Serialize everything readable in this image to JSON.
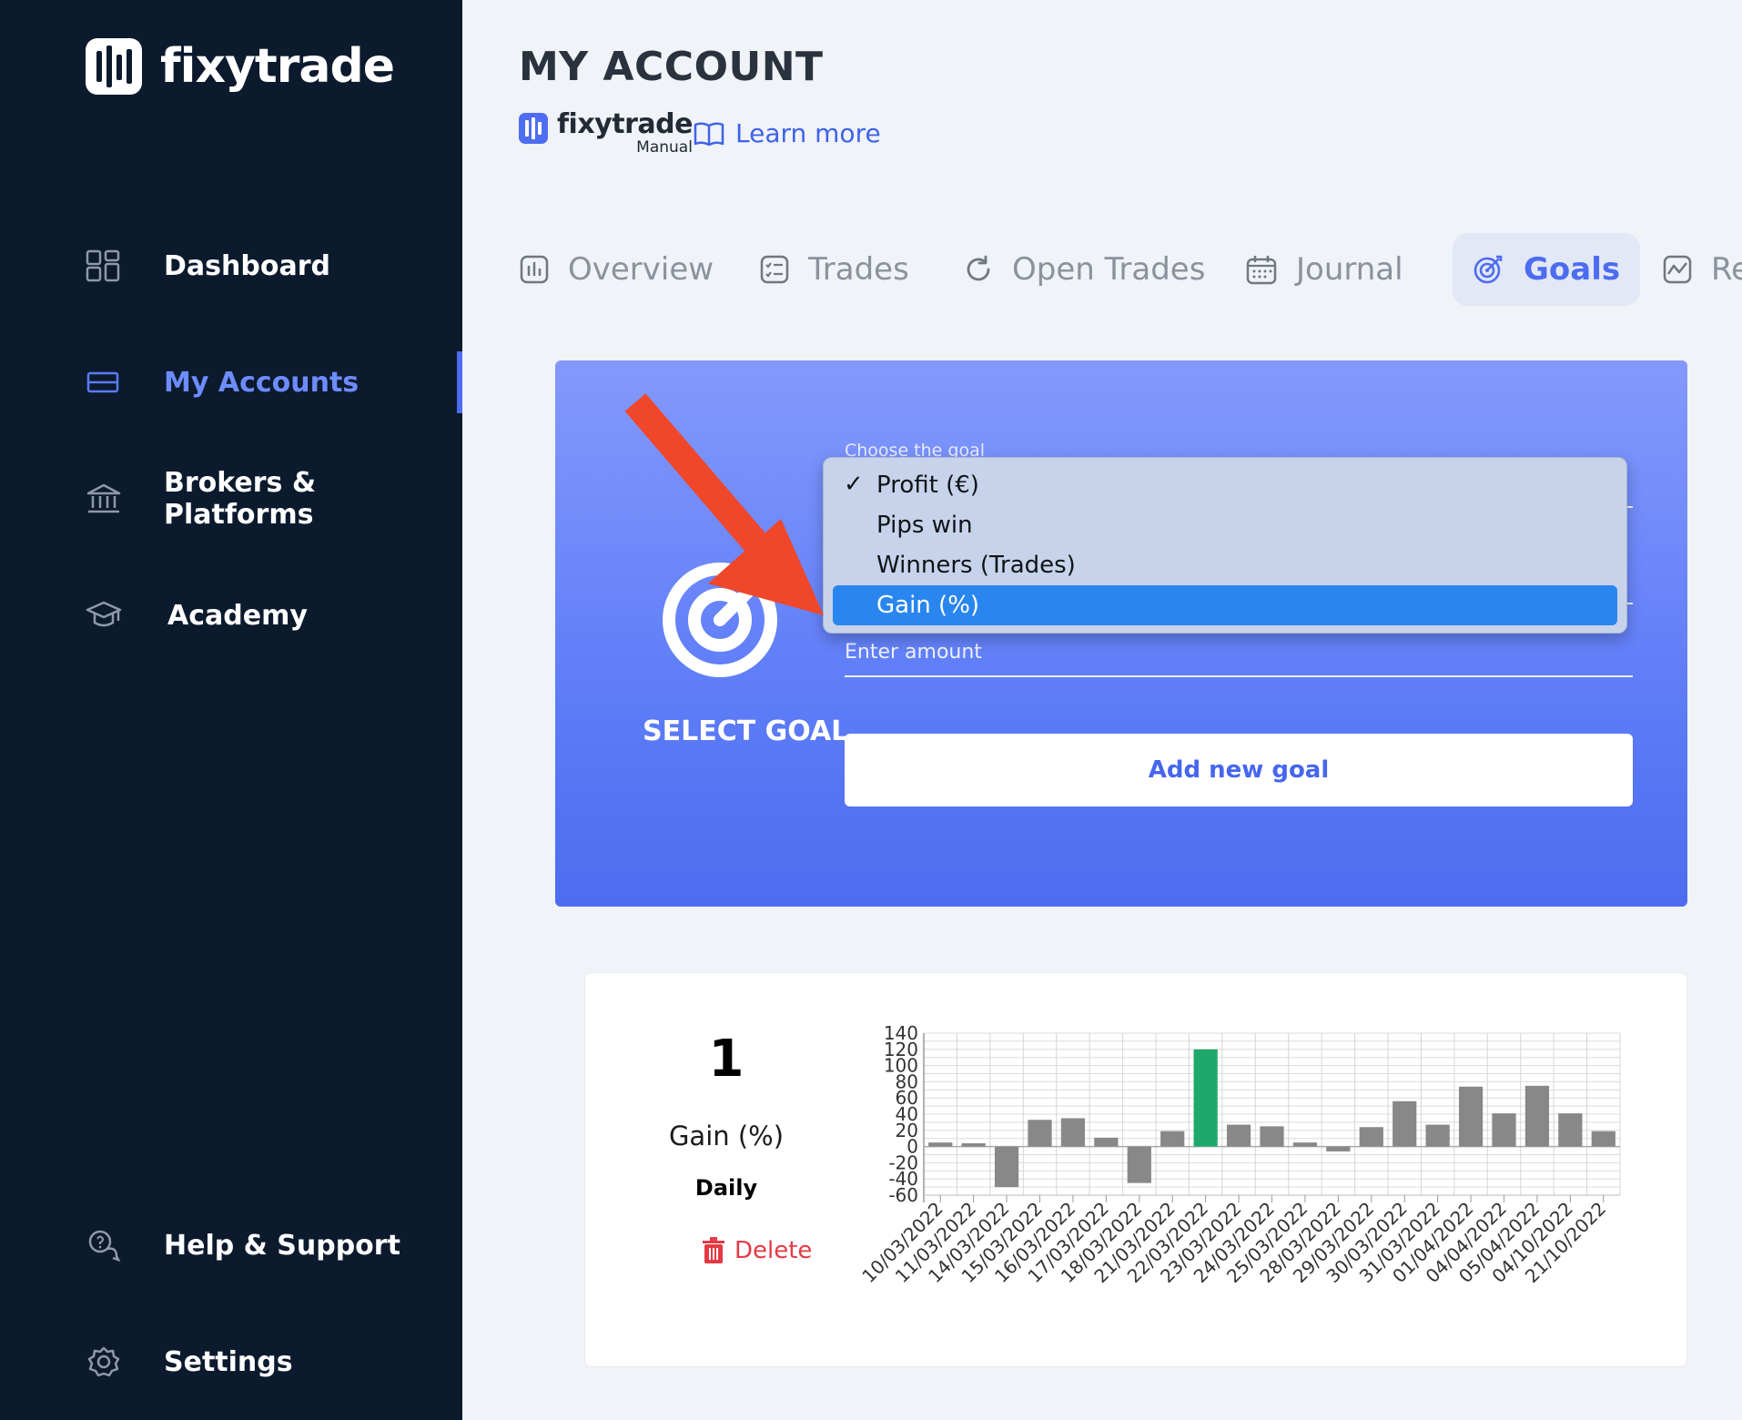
{
  "sidebar": {
    "brand": "fixytrade",
    "items": [
      {
        "label": "Dashboard",
        "icon": "dashboard-grid-icon"
      },
      {
        "label": "My Accounts",
        "icon": "credit-card-icon",
        "active": true
      },
      {
        "label": "Brokers & Platforms",
        "icon": "bank-icon"
      },
      {
        "label": "Academy",
        "icon": "graduation-cap-icon"
      },
      {
        "label": "Help & Support",
        "icon": "help-chat-icon"
      },
      {
        "label": "Settings",
        "icon": "gear-icon"
      }
    ]
  },
  "header": {
    "title": "MY ACCOUNT",
    "manual_logo_title": "fixytrade",
    "manual_logo_sub": "Manual",
    "learn_more": "Learn more"
  },
  "tabs": [
    {
      "label": "Overview",
      "icon": "bar-chart-icon"
    },
    {
      "label": "Trades",
      "icon": "checklist-icon"
    },
    {
      "label": "Open Trades",
      "icon": "refresh-icon"
    },
    {
      "label": "Journal",
      "icon": "calendar-icon"
    },
    {
      "label": "Goals",
      "icon": "target-icon",
      "active": true
    },
    {
      "label": "Re",
      "icon": "report-chart-icon"
    }
  ],
  "goal_form": {
    "caption": "SELECT GOAL",
    "choose_label": "Choose the goal",
    "amount_placeholder": "Enter amount",
    "add_button": "Add new goal",
    "options": [
      {
        "label": "Profit (€)",
        "checked": true
      },
      {
        "label": "Pips win"
      },
      {
        "label": "Winners (Trades)"
      },
      {
        "label": "Gain (%)",
        "highlighted": true
      }
    ]
  },
  "goal_stats": {
    "value": "1",
    "type": "Gain (%)",
    "frequency": "Daily",
    "delete": "Delete"
  },
  "colors": {
    "sidebar_bg": "#0c1a2e",
    "accent": "#4e6cf0",
    "bar_default": "#888888",
    "bar_highlight": "#20a86b",
    "dropdown_highlight": "#2a86ef",
    "arrow": "#f0462a",
    "delete": "#e43a45"
  },
  "chart_data": {
    "type": "bar",
    "categories": [
      "10/03/2022",
      "11/03/2022",
      "14/03/2022",
      "15/03/2022",
      "16/03/2022",
      "17/03/2022",
      "18/03/2022",
      "21/03/2022",
      "22/03/2022",
      "23/03/2022",
      "24/03/2022",
      "25/03/2022",
      "28/03/2022",
      "29/03/2022",
      "30/03/2022",
      "31/03/2022",
      "01/04/2022",
      "04/04/2022",
      "05/04/2022",
      "04/10/2022",
      "21/10/2022"
    ],
    "values": [
      5,
      4,
      -50,
      33,
      35,
      11,
      -45,
      19,
      120,
      27,
      25,
      5,
      -6,
      24,
      56,
      27,
      74,
      41,
      75,
      41,
      19
    ],
    "highlight_index": 8,
    "yticks": [
      140,
      120,
      100,
      80,
      60,
      40,
      20,
      0,
      -20,
      -40,
      -60
    ],
    "ylim": [
      -60,
      140
    ],
    "grid": true
  }
}
